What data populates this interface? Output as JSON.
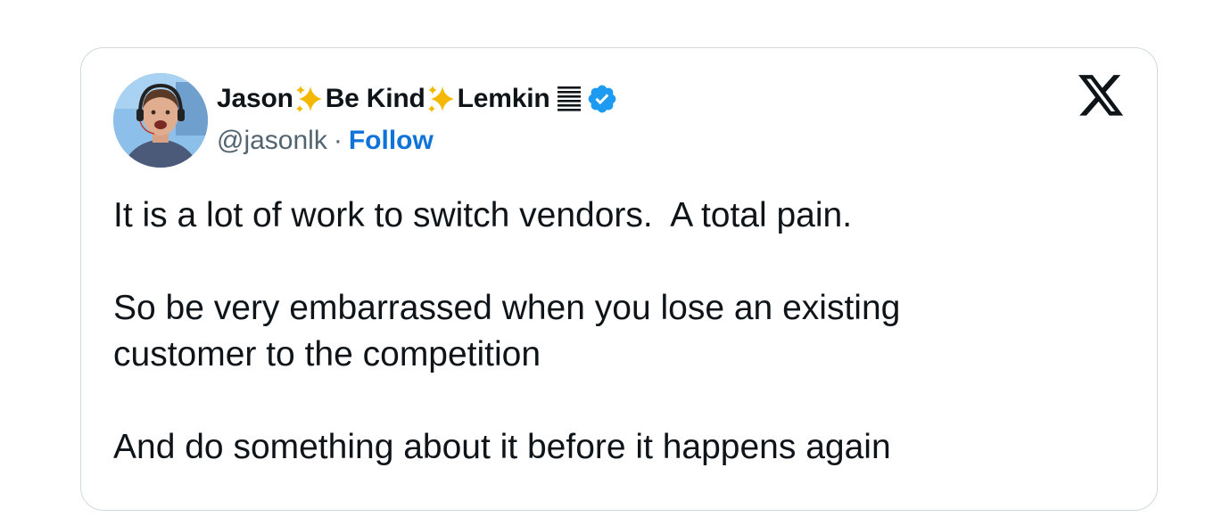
{
  "author": {
    "name_part1": "Jason ",
    "name_part2": "Be Kind",
    "name_part3": " Lemkin",
    "handle": "@jasonlk",
    "separator": "·",
    "follow_label": "Follow"
  },
  "icons": {
    "sparkle": "sparkles-icon",
    "list": "list-lines-icon",
    "verified": "verified-badge-icon",
    "brand": "x-logo-icon"
  },
  "colors": {
    "follow": "#0f73d9",
    "verified": "#1d9bf0",
    "sparkle": "#f5b800",
    "text": "#0f1419",
    "muted": "#536471",
    "border": "#cfd9de"
  },
  "tweet": {
    "paragraph1": "It is a lot of work to switch vendors.  A total pain.",
    "paragraph2": "So be very embarrassed when you lose an existing\ncustomer to the competition",
    "paragraph3": "And do something about it before it happens again"
  }
}
